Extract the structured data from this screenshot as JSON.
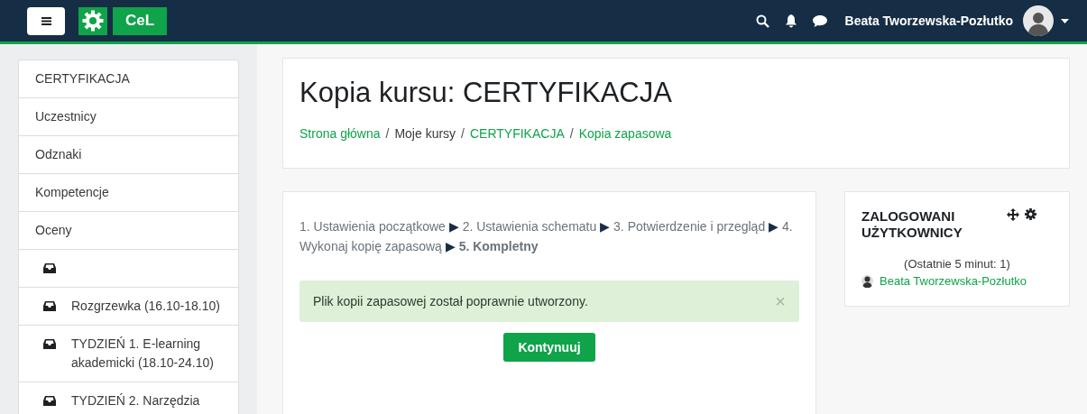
{
  "navbar": {
    "logo_text": "CeL",
    "user_name": "Beata Tworzewska-Pozłutko"
  },
  "sidebar": {
    "items": [
      {
        "kind": "text",
        "label": "CERTYFIKACJA"
      },
      {
        "kind": "text",
        "label": "Uczestnicy"
      },
      {
        "kind": "text",
        "label": "Odznaki"
      },
      {
        "kind": "text",
        "label": "Kompetencje"
      },
      {
        "kind": "text",
        "label": "Oceny"
      },
      {
        "kind": "section"
      },
      {
        "kind": "section",
        "label": "Rozgrzewka (16.10-18.10)"
      },
      {
        "kind": "section",
        "label": "TYDZIEŃ 1. E-learning akademicki (18.10-24.10)"
      },
      {
        "kind": "section",
        "label": "TYDZIEŃ 2. Narzędzia"
      }
    ]
  },
  "header": {
    "title": "Kopia kursu: CERTYFIKACJA",
    "breadcrumb": [
      {
        "label": "Strona główna",
        "link": true
      },
      {
        "label": "Moje kursy",
        "link": false
      },
      {
        "label": "CERTYFIKACJA",
        "link": true
      },
      {
        "label": "Kopia zapasowa",
        "link": true
      }
    ],
    "separator": "/"
  },
  "main": {
    "steps": [
      {
        "label": "1. Ustawienia początkowe",
        "selected": false
      },
      {
        "label": "2. Ustawienia schematu",
        "selected": false
      },
      {
        "label": "3. Potwierdzenie i przegląd",
        "selected": false
      },
      {
        "label": "4. Wykonaj kopię zapasową",
        "selected": false
      },
      {
        "label": "5. Kompletny",
        "selected": true
      }
    ],
    "step_separator": "▶",
    "alert": {
      "message": "Plik kopii zapasowej został poprawnie utworzony.",
      "close": "×"
    },
    "button": "Kontynuuj"
  },
  "block": {
    "title": "ZALOGOWANI UŻYTKOWNICY",
    "info": "(Ostatnie 5 minut: 1)",
    "users": [
      "Beata Tworzewska-Pozłutko"
    ]
  }
}
